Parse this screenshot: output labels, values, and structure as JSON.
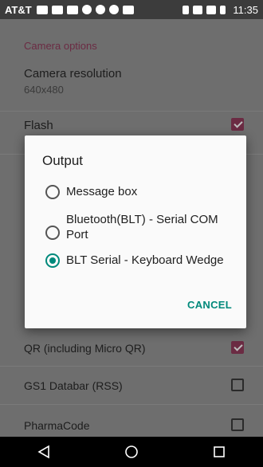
{
  "status_bar": {
    "carrier": "AT&T",
    "time": "11:35"
  },
  "settings": {
    "section_header": "Camera options",
    "camera_resolution": {
      "title": "Camera resolution",
      "summary": "640x480"
    },
    "flash": {
      "title": "Flash",
      "checked": true
    },
    "qr": {
      "title": "QR (including Micro QR)",
      "checked": true
    },
    "gs1": {
      "title": "GS1 Databar (RSS)",
      "checked": false
    },
    "pharmacode": {
      "title": "PharmaCode",
      "checked": false
    }
  },
  "dialog": {
    "title": "Output",
    "options": [
      {
        "label": "Message box",
        "selected": false
      },
      {
        "label": "Bluetooth(BLT) - Serial COM Port",
        "selected": false
      },
      {
        "label": "BLT Serial - Keyboard Wedge",
        "selected": true
      }
    ],
    "cancel_label": "CANCEL"
  },
  "colors": {
    "accent": "#00897b",
    "section_header": "#6b2b43"
  },
  "navbar": {
    "icons": [
      "back-icon",
      "home-icon",
      "recents-icon"
    ]
  }
}
